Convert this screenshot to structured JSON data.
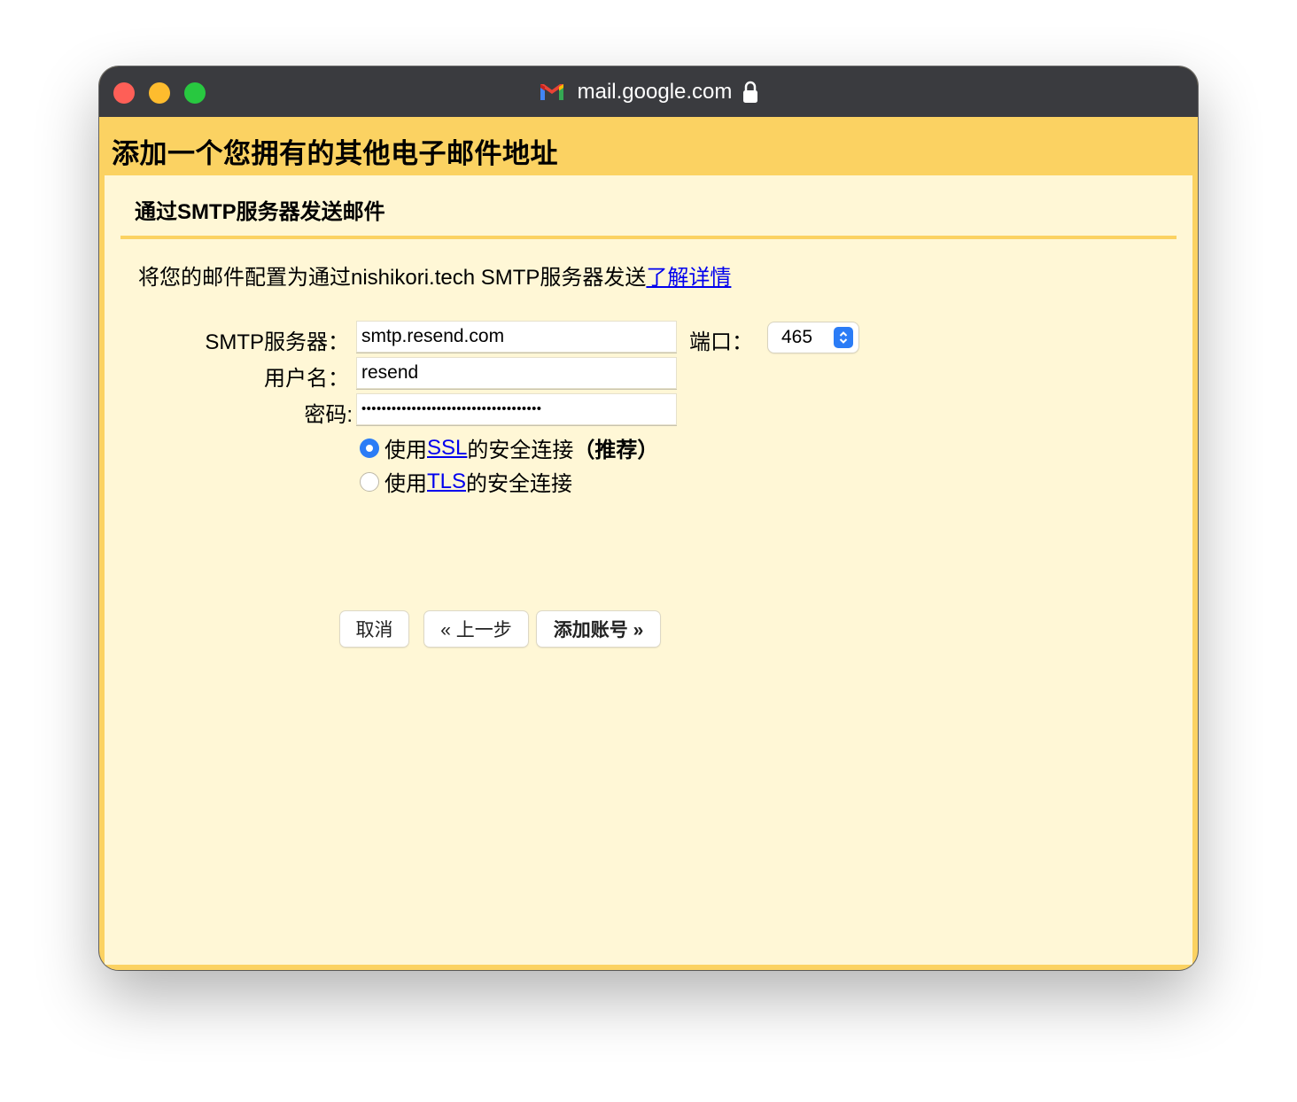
{
  "window": {
    "url": "mail.google.com"
  },
  "header": {
    "title": "添加一个您拥有的其他电子邮件地址"
  },
  "section": {
    "title": "通过SMTP服务器发送邮件",
    "description": "将您的邮件配置为通过nishikori.tech SMTP服务器发送",
    "learn_more": "了解详情"
  },
  "form": {
    "smtp_label": "SMTP服务器：",
    "smtp_value": "smtp.resend.com",
    "port_label": "端口：",
    "port_value": "465",
    "username_label": "用户名：",
    "username_value": "resend",
    "password_label": "密码:",
    "password_value": "••••••••••••••••••••••••••••••••••••",
    "ssl_prefix": "使用",
    "ssl_link": "SSL",
    "ssl_suffix": "的安全连接",
    "ssl_recommended": "（推荐）",
    "tls_prefix": "使用",
    "tls_link": "TLS",
    "tls_suffix": "的安全连接",
    "selected_security": "SSL"
  },
  "buttons": {
    "cancel": "取消",
    "back": "« 上一步",
    "add_account": "添加账号 »"
  },
  "colors": {
    "accent": "#fbd262",
    "panel": "#fff7d6",
    "link": "#0000ee",
    "radio_selected": "#2b7cf6",
    "titlebar": "#3a3b3f"
  }
}
